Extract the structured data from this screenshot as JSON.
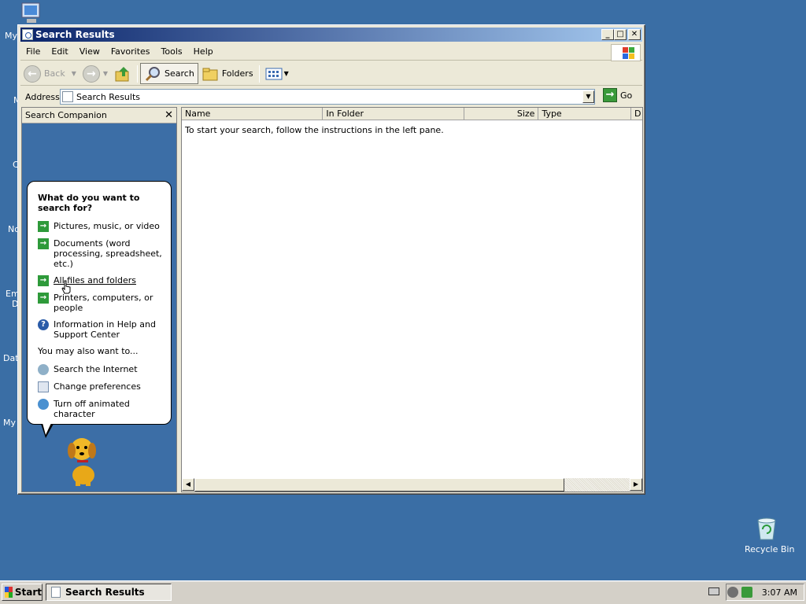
{
  "window": {
    "title": "Search Results",
    "controls": {
      "minimize": "_",
      "maximize": "□",
      "close": "✕"
    }
  },
  "menu": [
    "File",
    "Edit",
    "View",
    "Favorites",
    "Tools",
    "Help"
  ],
  "toolbar": {
    "back_label": "Back",
    "search_label": "Search",
    "folders_label": "Folders"
  },
  "address": {
    "label": "Address",
    "value": "Search Results",
    "go_label": "Go"
  },
  "companion": {
    "header": "Search Companion",
    "close": "✕",
    "question": "What do you want to search for?",
    "options": [
      {
        "label": "Pictures, music, or video",
        "icon": "green-arrow-icon"
      },
      {
        "label": "Documents (word processing, spreadsheet, etc.)",
        "icon": "green-arrow-icon"
      },
      {
        "label": "All files and folders",
        "icon": "green-arrow-icon"
      },
      {
        "label": "Printers, computers, or people",
        "icon": "green-arrow-icon"
      },
      {
        "label": "Information in Help and Support Center",
        "icon": "help-icon"
      }
    ],
    "also_label": "You may also want to...",
    "extra": [
      {
        "label": "Search the Internet",
        "icon": "globe-search-icon"
      },
      {
        "label": "Change preferences",
        "icon": "preferences-icon"
      },
      {
        "label": "Turn off animated character",
        "icon": "character-icon"
      }
    ]
  },
  "results": {
    "columns": [
      "Name",
      "In Folder",
      "Size",
      "Type",
      "D"
    ],
    "empty_message": "To start your search, follow the instructions in the left pane."
  },
  "desktop": {
    "labels": [
      "My",
      "M",
      "C",
      "No",
      "Em",
      "D",
      "Dat",
      "My I"
    ],
    "recycle_bin": "Recycle Bin"
  },
  "taskbar": {
    "start_label": "Start",
    "task_label": "Search Results",
    "clock": "3:07 AM"
  }
}
